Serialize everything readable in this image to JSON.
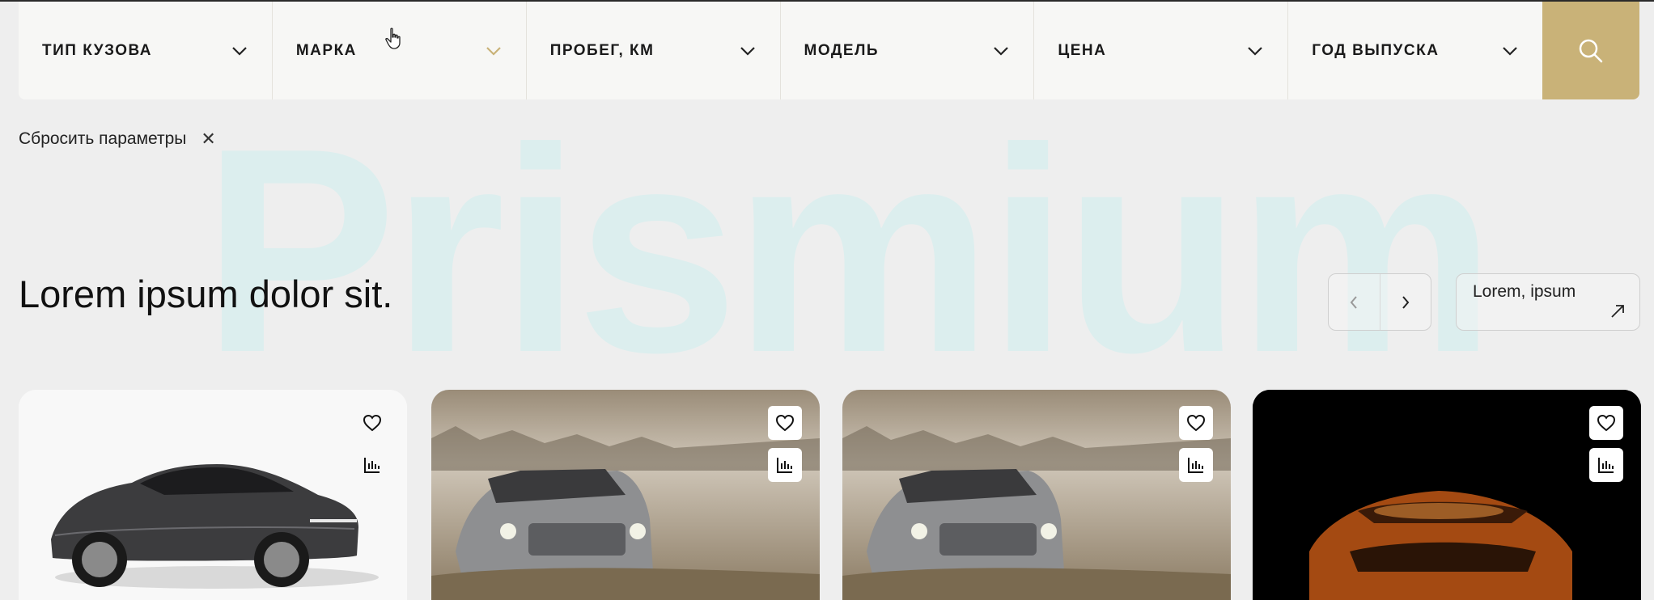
{
  "filters": [
    {
      "label": "ТИП КУЗОВА"
    },
    {
      "label": "МАРКА"
    },
    {
      "label": "ПРОБЕГ, КМ"
    },
    {
      "label": "МОДЕЛЬ"
    },
    {
      "label": "ЦЕНА"
    },
    {
      "label": "ГОД ВЫПУСКА"
    }
  ],
  "search_icon": "search-icon",
  "reset": {
    "label": "Сбросить параметры",
    "icon": "close-icon"
  },
  "watermark": "Prismium",
  "section": {
    "title": "Lorem ipsum dolor sit."
  },
  "more_button": {
    "label": "Lorem, ipsum",
    "icon": "arrow-up-right-icon"
  },
  "cards": [
    {
      "photo": "gray-sedan",
      "icons": [
        "heart-icon",
        "chart-icon"
      ]
    },
    {
      "photo": "silver-suv-fog",
      "icons": [
        "heart-icon",
        "chart-icon"
      ]
    },
    {
      "photo": "silver-suv-fog",
      "icons": [
        "heart-icon",
        "chart-icon"
      ]
    },
    {
      "photo": "orange-sportscar-dark",
      "icons": [
        "heart-icon",
        "chart-icon"
      ]
    }
  ],
  "colors": {
    "accent": "#c9b278",
    "background": "#eeeeee",
    "watermark": "#d9eeee"
  }
}
